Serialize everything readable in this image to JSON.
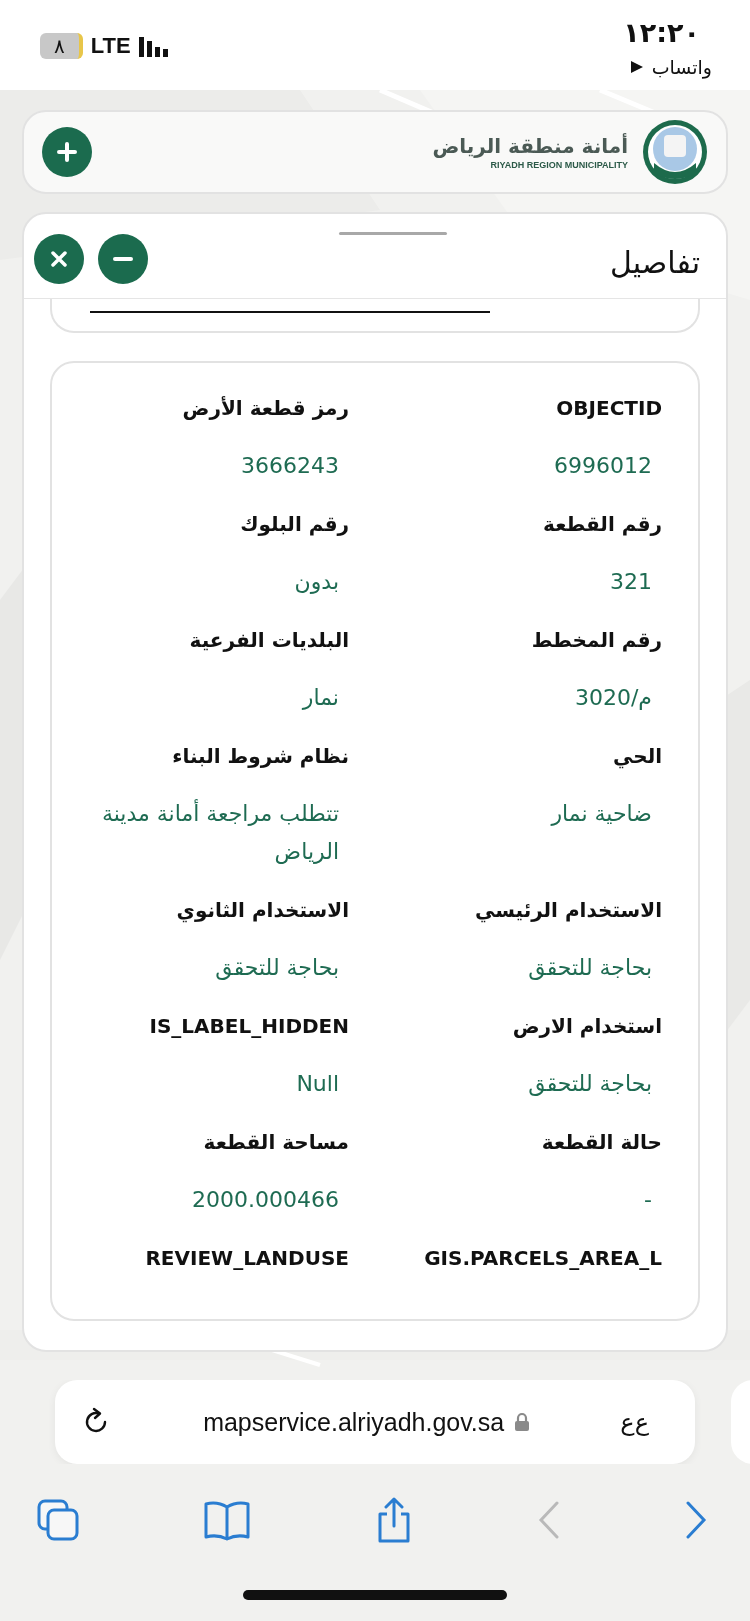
{
  "status_bar": {
    "time": "١٢:٢٠",
    "back_app": "واتساب",
    "battery": "٨",
    "network": "LTE"
  },
  "header": {
    "title_ar": "أمانة منطقة الرياض",
    "title_en": "RIYADH REGION MUNICIPALITY"
  },
  "panel": {
    "title": "تفاصيل",
    "fields": [
      {
        "label": "OBJECTID",
        "value": "6996012"
      },
      {
        "label": "رمز قطعة الأرض",
        "value": "3666243"
      },
      {
        "label": "رقم القطعة",
        "value": "321"
      },
      {
        "label": "رقم البلوك",
        "value": "بدون"
      },
      {
        "label": "رقم المخطط",
        "value": "م/3020"
      },
      {
        "label": "البلديات الفرعية",
        "value": "نمار"
      },
      {
        "label": "الحي",
        "value": "ضاحية نمار"
      },
      {
        "label": "نظام شروط البناء",
        "value": "تتطلب مراجعة أمانة مدينة الرياض"
      },
      {
        "label": "الاستخدام الرئيسي",
        "value": "بحاجة للتحقق"
      },
      {
        "label": "الاستخدام الثانوي",
        "value": "بحاجة للتحقق"
      },
      {
        "label": "استخدام الارض",
        "value": "بحاجة للتحقق"
      },
      {
        "label": "IS_LABEL_HIDDEN",
        "value": "Null"
      },
      {
        "label": "حالة القطعة",
        "value": "-"
      },
      {
        "label": "مساحة القطعة",
        "value": "2000.000466"
      },
      {
        "label": "GIS.PARCELS_AREA_L"
      },
      {
        "label": "REVIEW_LANDUSE"
      }
    ]
  },
  "browser": {
    "url": "mapservice.alriyadh.gov.sa",
    "text_size": "ﻉﻉ"
  }
}
